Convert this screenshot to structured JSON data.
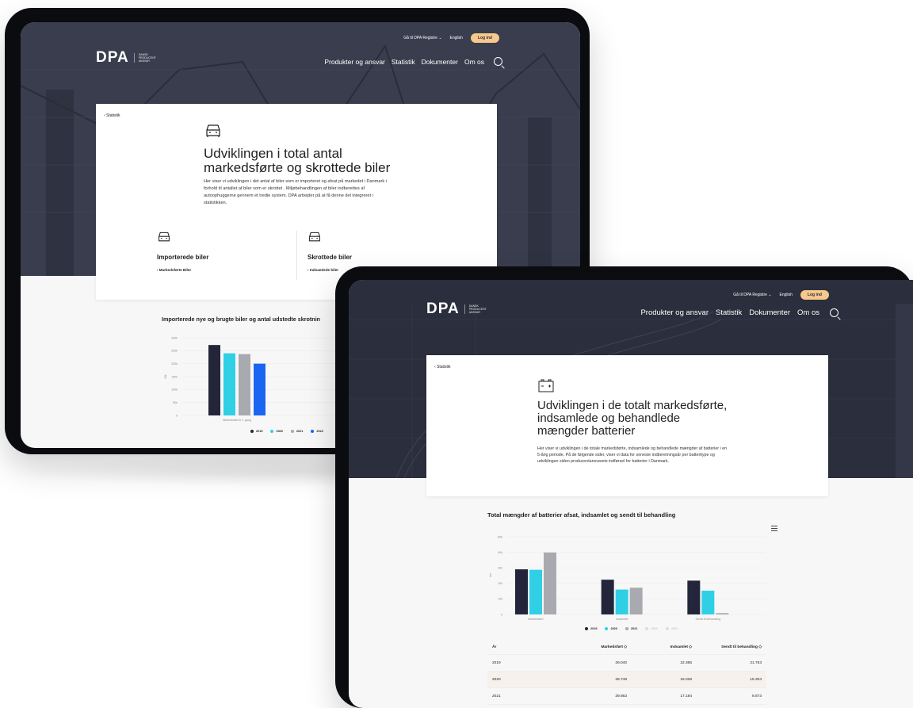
{
  "brand": {
    "logo": "DPA",
    "tagline": [
      "DANSK",
      "PRODUCENT",
      "ANSVAR"
    ]
  },
  "topbar": {
    "registry": "Gå til DPA Registre ⌄",
    "language": "English",
    "login": "Log ind"
  },
  "nav": [
    "Produkter og ansvar",
    "Statistik",
    "Dokumenter",
    "Om os"
  ],
  "colors": {
    "navy": "#23263a",
    "cyan": "#2fd0e5",
    "grey": "#a9aab0",
    "blue": "#1a66f0",
    "gold": "#e8c46e",
    "hero_dark": "#3a3d4d",
    "login": "#f6c88b"
  },
  "screen1": {
    "back": "‹ Statistik",
    "icon": "car-icon",
    "title": "Udviklingen i total antal markedsførte og skrottede biler",
    "description": "Her viser vi udviklingen i det antal af biler som er importeret og afsat på markedet i Danmark i forhold til antallet af biler som er skrottet . Miljøbehandlingen af biler indberettes af autoophuggerne gennem et tredie system. DPA arbejder på at få denne del integreret i statistikken.",
    "subcards": [
      {
        "icon": "car-icon",
        "name": "Importerede biler",
        "link": "› Markedsførte Biler"
      },
      {
        "icon": "car-icon",
        "name": "Skrottede biler",
        "link": "› Indsamlede biler"
      }
    ],
    "chart_title": "Importerede nye og brugte biler og antal udstedte skrotnin",
    "chart_data": {
      "type": "bar",
      "categories": [
        "Markedsført til 1. gang"
      ],
      "ylabel": "Stk",
      "yticks": [
        "0",
        "50k",
        "100k",
        "150k",
        "200k",
        "250k",
        "300k"
      ],
      "ylim": [
        0,
        300000
      ],
      "series": [
        {
          "name": "2019",
          "values": [
            272000
          ]
        },
        {
          "name": "2020",
          "values": [
            240000
          ]
        },
        {
          "name": "2021",
          "values": [
            237000
          ]
        },
        {
          "name": "2022",
          "values": [
            200000
          ]
        }
      ]
    },
    "legend": [
      "2019",
      "2020",
      "2021",
      "2022"
    ]
  },
  "screen2": {
    "back": "‹ Statistik",
    "icon": "battery-icon",
    "title": "Udviklingen i de totalt markedsførte, indsamlede og behandlede mængder batterier",
    "description": "Her viser vi udviklingen i de totale markedsførte, indsamlede og behandlede mængder af batterier i en 5-årig periode. På de følgende sider, viser vi data for seneste indberetningsår per batteritype og udviklingen siden producentansvarets indførsel for batterier i Danmark.",
    "chart_title": "Total mængder af batterier afsat, indsamlet og sendt til behandling",
    "chart_data": {
      "type": "bar",
      "categories": [
        "Markedsført",
        "Indsamlet",
        "Sendt til behandling"
      ],
      "ylabel": "Ton",
      "yticks": [
        "0",
        "10k",
        "20k",
        "30k",
        "40k",
        "50k"
      ],
      "ylim": [
        0,
        50000
      ],
      "series": [
        {
          "name": "2019",
          "values": [
            29040,
            22365,
            21763
          ]
        },
        {
          "name": "2020",
          "values": [
            28748,
            16028,
            15304
          ]
        },
        {
          "name": "2021",
          "values": [
            39863,
            17184,
            873
          ]
        }
      ]
    },
    "legend": [
      "2019",
      "2020",
      "2021",
      "2022",
      "2023"
    ],
    "table": {
      "headers": [
        "År",
        "Markedsført ◇",
        "Indsamlet ◇",
        "Sendt til behandling ◇"
      ],
      "rows": [
        [
          "2019",
          "29.040",
          "22.365",
          "21.763"
        ],
        [
          "2020",
          "28.748",
          "16.028",
          "15.304"
        ],
        [
          "2021",
          "39.863",
          "17.184",
          "8.873"
        ]
      ]
    }
  }
}
